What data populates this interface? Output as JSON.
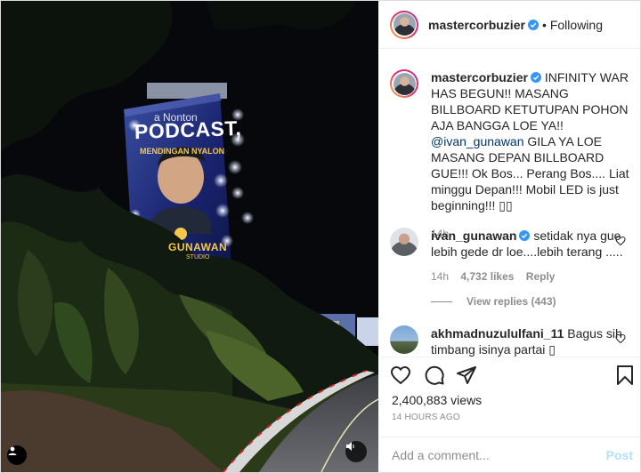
{
  "media": {
    "billboard": {
      "line1": "a Nonton",
      "headline": "PODCAST,",
      "tagline": "MENDINGAN NYALON",
      "brand": "GUNAWAN",
      "brand_sub": "STUDIO"
    },
    "mute_icon": "speaker-muted-icon",
    "tag_icon": "user-tag-icon"
  },
  "header": {
    "username": "mastercorbuzier",
    "separator": "•",
    "follow_status": "Following"
  },
  "caption": {
    "username": "mastercorbuzier",
    "text_part1": " INFINITY WAR HAS BEGUN!! MASANG BILLBOARD KETUTUPAN POHON AJA BANGGA LOE YA!! ",
    "mention": "@ivan_gunawan",
    "text_part2": " GILA YA LOE MASANG DEPAN BILLBOARD GUE!!! Ok Bos... Perang Bos.... Liat minggu Depan!!! Mobil LED is just beginning!!! ",
    "emoji": "▯▯",
    "age": "14h"
  },
  "comments": [
    {
      "username": "ivan_gunawan",
      "text": " setidak nya gue lebih gede dr loe....lebih terang .....",
      "age": "14h",
      "likes": "4,732 likes",
      "reply_label": "Reply",
      "view_replies": "View replies (443)"
    },
    {
      "username": "akhmadnuzululfani_11",
      "text": " Bagus sih timbang isinya partai ▯"
    }
  ],
  "stats": {
    "views": "2,400,883 views",
    "timestamp": "14 HOURS AGO"
  },
  "add_comment": {
    "placeholder": "Add a comment...",
    "post_label": "Post"
  },
  "colors": {
    "verified": "#3897f0",
    "mention": "#00376b",
    "post_disabled": "#b2dffc",
    "muted_text": "#8e8e8e"
  }
}
